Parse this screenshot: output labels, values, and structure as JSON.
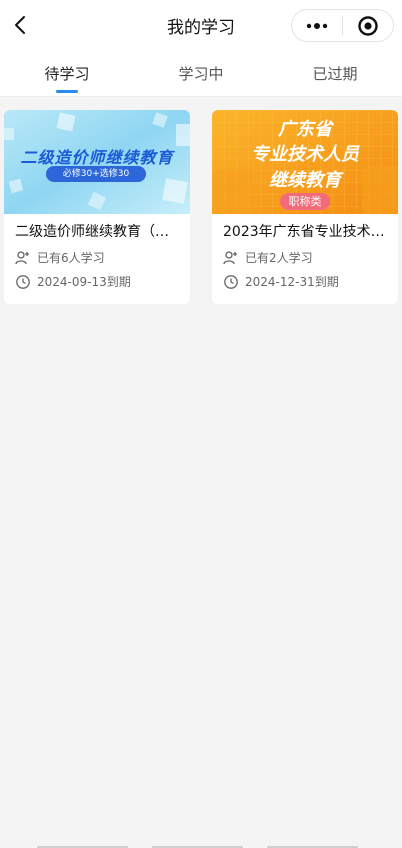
{
  "navbar": {
    "title": "我的学习",
    "back_icon": "chevron-left-icon",
    "more_icon": "more-dots-icon",
    "close_icon": "target-circle-icon"
  },
  "tabs": [
    {
      "label": "待学习",
      "active": true
    },
    {
      "label": "学习中",
      "active": false
    },
    {
      "label": "已过期",
      "active": false
    }
  ],
  "courses": [
    {
      "cover_title": "二级造价师继续教育",
      "cover_badge": "必修30+选修30",
      "title": "二级造价师继续教育（…",
      "learners": "已有6人学习",
      "expires": "2024-09-13到期"
    },
    {
      "cover_lines": [
        "广东省",
        "专业技术人员",
        "继续教育"
      ],
      "cover_badge": "职称类",
      "title": "2023年广东省专业技术…",
      "learners": "已有2人学习",
      "expires": "2024-12-31到期"
    }
  ],
  "colors": {
    "accent": "#2a8cf0",
    "cover1_bg": "#8fd6f2",
    "cover2_bg": "#f8a51a"
  }
}
